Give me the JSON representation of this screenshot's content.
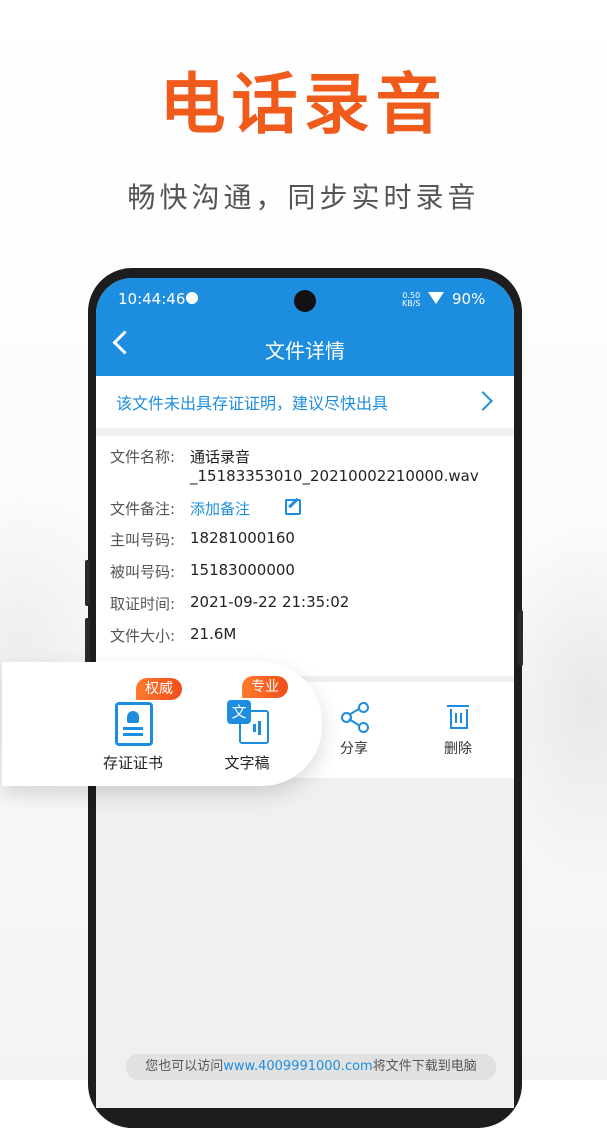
{
  "hero": {
    "title": "电话录音",
    "subtitle": "畅快沟通，同步实时录音"
  },
  "status_bar": {
    "time": "10:44:46",
    "net_speed_value": "0.50",
    "net_speed_unit": "KB/S",
    "battery": "90%"
  },
  "app_bar": {
    "title": "文件详情"
  },
  "notice": {
    "text": "该文件未出具存证证明，建议尽快出具"
  },
  "details": {
    "file_name_label": "文件名称:",
    "file_name_line1": "通话录音",
    "file_name_line2": "_15183353010_20210002210000.wav",
    "note_label": "文件备注:",
    "note_action": "添加备注",
    "caller_label": "主叫号码:",
    "caller": "18281000160",
    "callee_label": "被叫号码:",
    "callee": "15183000000",
    "time_label": "取证时间:",
    "time": "2021-09-22 21:35:02",
    "size_label": "文件大小:",
    "size": "21.6M"
  },
  "actions": {
    "share": "分享",
    "delete": "删除"
  },
  "float_card": {
    "certificate_label": "存证证书",
    "certificate_badge": "权威",
    "transcript_label": "文字稿",
    "transcript_badge": "专业",
    "transcript_glyph": "文"
  },
  "footer": {
    "prefix": "您也可以访问",
    "url": "www.4009991000.com",
    "suffix": "将文件下载到电脑"
  },
  "colors": {
    "accent": "#1d8de0",
    "brand_orange": "#f05a1a"
  },
  "icons": [
    "chevron-left-icon",
    "chevron-right-icon",
    "edit-icon",
    "share-icon",
    "trash-icon",
    "certificate-icon",
    "transcript-icon",
    "wifi-icon",
    "clock-icon"
  ]
}
